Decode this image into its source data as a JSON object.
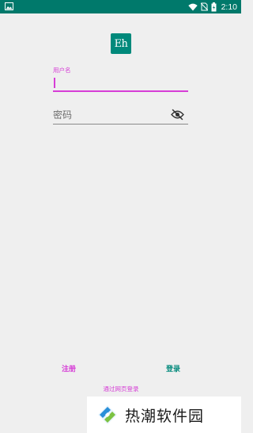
{
  "status_bar": {
    "time": "2:10",
    "icons": [
      "image-icon",
      "wifi-icon",
      "no-sim-icon",
      "battery-icon"
    ],
    "color": "#00796b"
  },
  "app": {
    "logo_text": "Eh",
    "logo_color": "#00897b"
  },
  "form": {
    "username_label": "用户名",
    "username_value": "",
    "password_placeholder": "密码",
    "password_value": "",
    "accent_color": "#d63dd6"
  },
  "actions": {
    "register_label": "注册",
    "login_label": "登录",
    "web_login_label": "通过网页登录"
  },
  "watermark": {
    "text": "热潮软件园"
  }
}
